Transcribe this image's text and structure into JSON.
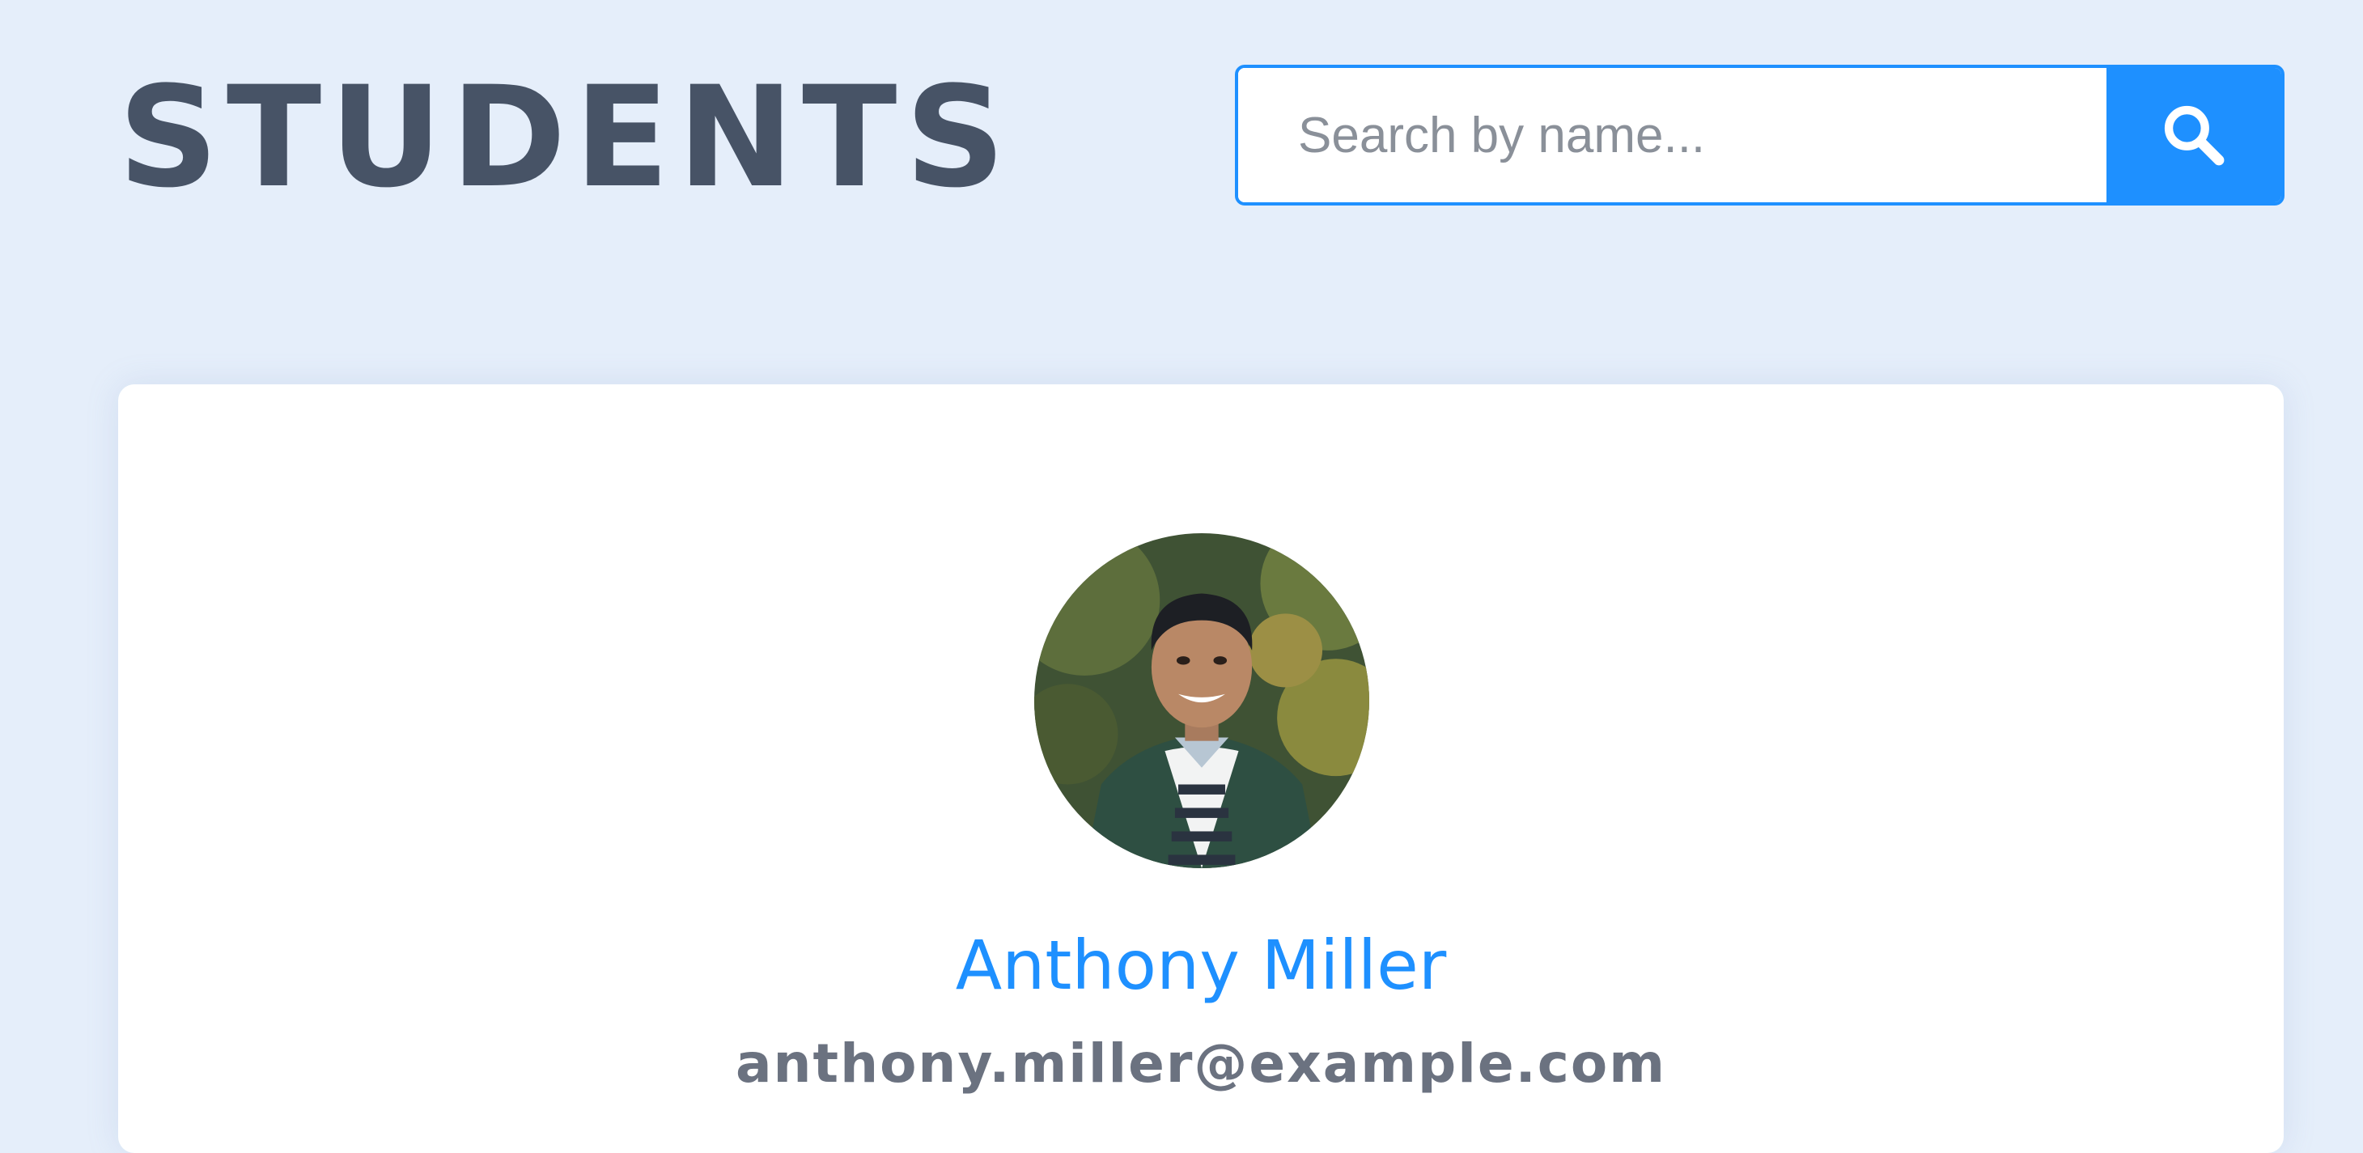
{
  "header": {
    "title": "STUDENTS"
  },
  "search": {
    "placeholder": "Search by name...",
    "value": "",
    "button_icon": "search-icon"
  },
  "student": {
    "name": "Anthony Miller",
    "email": "anthony.miller@example.com",
    "avatar_icon": "student-avatar-photo"
  },
  "colors": {
    "background": "#e5eefa",
    "title": "#475366",
    "accent": "#1e90ff",
    "name": "#1e90ff",
    "email": "#6b7280",
    "card": "#ffffff"
  }
}
